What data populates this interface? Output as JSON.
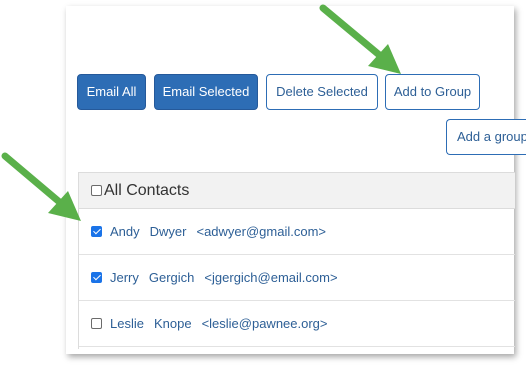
{
  "toolbar": {
    "email_all": "Email All",
    "email_selected": "Email Selected",
    "delete_selected": "Delete Selected",
    "add_to_group": "Add to Group",
    "add_a_group": "Add a group"
  },
  "contacts": {
    "header_label": "All Contacts",
    "header_checked": false,
    "rows": [
      {
        "first": "Andy",
        "last": "Dwyer",
        "email": "<adwyer@gmail.com>",
        "checked": true
      },
      {
        "first": "Jerry",
        "last": "Gergich",
        "email": "<jgergich@email.com>",
        "checked": true
      },
      {
        "first": "Leslie",
        "last": "Knope",
        "email": "<leslie@pawnee.org>",
        "checked": false
      }
    ]
  },
  "colors": {
    "primary": "#2d6db5",
    "link": "#2d5f96",
    "annotation_arrow": "#5ab04a"
  }
}
